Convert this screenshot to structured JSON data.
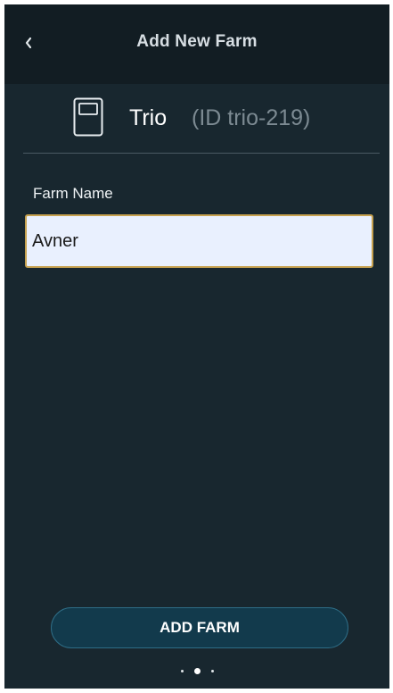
{
  "header": {
    "title": "Add New Farm",
    "back_icon": "chevron-left-icon"
  },
  "device": {
    "icon": "controller-device-icon",
    "name": "Trio",
    "id_text": "(ID trio-219)"
  },
  "form": {
    "farm_name_label": "Farm Name",
    "farm_name_value": "Avner"
  },
  "actions": {
    "add_farm_label": "ADD FARM"
  },
  "pager": {
    "total_pages": 3,
    "current_page": 2
  },
  "colors": {
    "background": "#18272f",
    "header_background": "#121d23",
    "input_background": "#e9f0fe",
    "input_border": "#c6a14f",
    "button_background": "#123a4c",
    "button_border": "#2e6d86"
  }
}
